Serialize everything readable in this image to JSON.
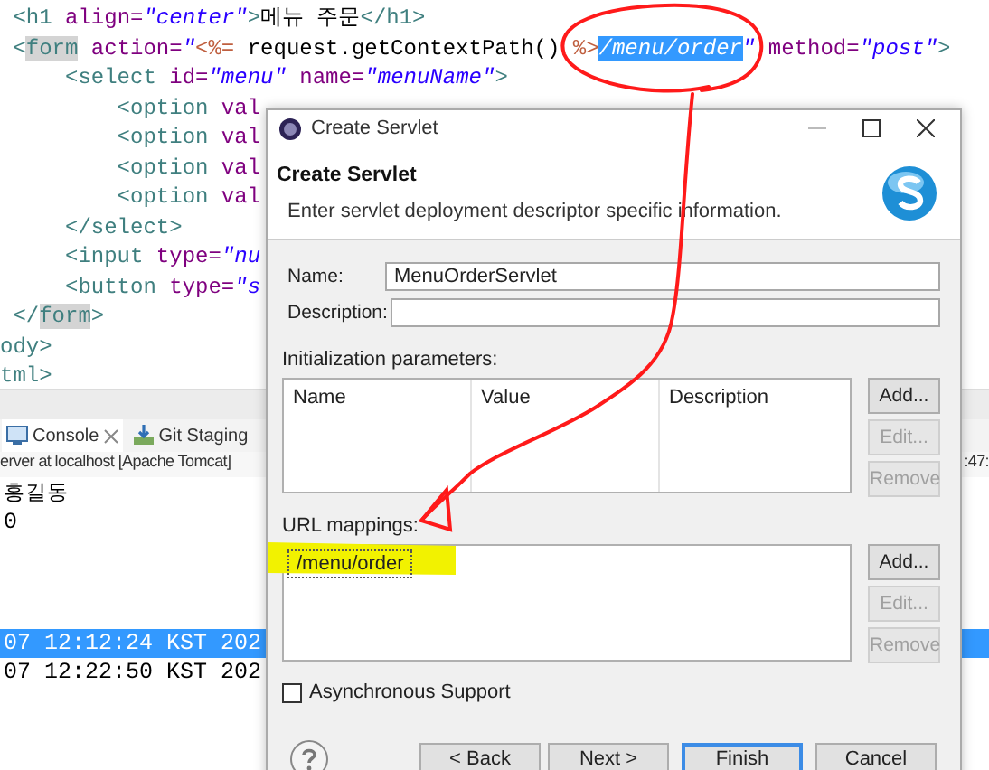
{
  "editor": {
    "lines": [
      {
        "segments": [
          {
            "kind": "tag",
            "text": " <h1"
          },
          {
            "kind": "attr",
            "text": " align="
          },
          {
            "kind": "value",
            "text": "\"center\""
          },
          {
            "kind": "tag",
            "text": ">"
          },
          {
            "kind": "plain",
            "text": "메뉴 주문"
          },
          {
            "kind": "tag",
            "text": "</h1>"
          }
        ]
      },
      {
        "segments": [
          {
            "kind": "tag",
            "text": " <"
          },
          {
            "kind": "match",
            "text": "form"
          },
          {
            "kind": "attr",
            "text": " action="
          },
          {
            "kind": "value",
            "text": "\""
          },
          {
            "kind": "jsp",
            "text": "<%="
          },
          {
            "kind": "plain",
            "text": " request.getContextPath() "
          },
          {
            "kind": "jsp",
            "text": "%>"
          },
          {
            "kind": "selection",
            "text": "/menu/order"
          },
          {
            "kind": "value",
            "text": "\""
          },
          {
            "kind": "attr",
            "text": " method="
          },
          {
            "kind": "value",
            "text": "\"post\""
          },
          {
            "kind": "tag",
            "text": ">"
          }
        ]
      },
      {
        "segments": [
          {
            "kind": "tag",
            "text": "     <select"
          },
          {
            "kind": "attr",
            "text": " id="
          },
          {
            "kind": "value",
            "text": "\"menu\""
          },
          {
            "kind": "attr",
            "text": " name="
          },
          {
            "kind": "value",
            "text": "\"menuName\""
          },
          {
            "kind": "tag",
            "text": ">"
          }
        ]
      },
      {
        "segments": [
          {
            "kind": "tag",
            "text": "         <option"
          },
          {
            "kind": "attr",
            "text": " val"
          }
        ]
      },
      {
        "segments": [
          {
            "kind": "tag",
            "text": "         <option"
          },
          {
            "kind": "attr",
            "text": " val"
          }
        ]
      },
      {
        "segments": [
          {
            "kind": "tag",
            "text": "         <option"
          },
          {
            "kind": "attr",
            "text": " val"
          }
        ]
      },
      {
        "segments": [
          {
            "kind": "tag",
            "text": "         <option"
          },
          {
            "kind": "attr",
            "text": " val"
          }
        ]
      },
      {
        "segments": [
          {
            "kind": "tag",
            "text": "     </select>"
          }
        ]
      },
      {
        "segments": [
          {
            "kind": "tag",
            "text": "     <input"
          },
          {
            "kind": "attr",
            "text": " type="
          },
          {
            "kind": "value",
            "text": "\"nu"
          }
        ]
      },
      {
        "segments": [
          {
            "kind": "tag",
            "text": "     <button"
          },
          {
            "kind": "attr",
            "text": " type="
          },
          {
            "kind": "value",
            "text": "\"s"
          }
        ]
      },
      {
        "segments": [
          {
            "kind": "tag",
            "text": " </"
          },
          {
            "kind": "match",
            "text": "form"
          },
          {
            "kind": "tag",
            "text": ">"
          }
        ]
      },
      {
        "segments": [
          {
            "kind": "tag",
            "text": "ody>"
          }
        ]
      },
      {
        "segments": [
          {
            "kind": "tag",
            "text": "tml>"
          }
        ]
      }
    ]
  },
  "console": {
    "tabs": [
      {
        "label": "Console",
        "selected": true
      },
      {
        "label": "Git Staging",
        "selected": false
      }
    ],
    "server": "erver at localhost [Apache Tomcat]",
    "server_tail": ":47:",
    "lines": [
      {
        "text": "홍길동",
        "selected": false
      },
      {
        "text": "0",
        "selected": false
      }
    ],
    "log": [
      {
        "text": "07 12:12:24 KST 202",
        "selected": true
      },
      {
        "text": "07 12:22:50 KST 202",
        "selected": false
      }
    ]
  },
  "dialog": {
    "title": "Create Servlet",
    "heading": "Create Servlet",
    "description": "Enter servlet deployment descriptor specific information.",
    "fields": [
      {
        "label": "Name:",
        "value": "MenuOrderServlet"
      },
      {
        "label": "Description:"
      }
    ],
    "init_params": {
      "label": "Initialization parameters:",
      "columns": [
        "Name",
        "Value",
        "Description"
      ],
      "buttons": [
        {
          "label": "Add...",
          "disabled": false
        },
        {
          "label": "Edit...",
          "disabled": true
        },
        {
          "label": "Remove",
          "disabled": true
        }
      ]
    },
    "url_mappings": {
      "label": "URL mappings:",
      "items": [
        {
          "text": "/menu/order",
          "selected": true
        }
      ],
      "buttons": [
        {
          "label": "Add...",
          "disabled": false
        },
        {
          "label": "Edit...",
          "disabled": true
        },
        {
          "label": "Remove",
          "disabled": true
        }
      ]
    },
    "async": {
      "label": "Asynchronous Support",
      "checked": false
    },
    "footer_buttons": [
      {
        "label": "< Back",
        "default": false
      },
      {
        "label": "Next >",
        "default": false
      },
      {
        "label": "Finish",
        "default": true
      },
      {
        "label": "Cancel",
        "default": false
      }
    ]
  }
}
